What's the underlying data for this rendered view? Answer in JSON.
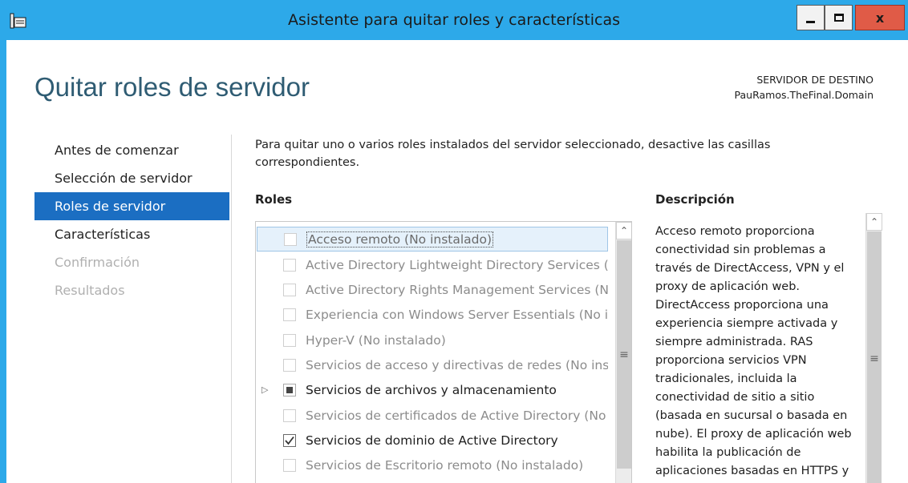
{
  "window": {
    "title": "Asistente para quitar roles y características",
    "icon": "server-manager-icon",
    "controls": {
      "minimize": "minimize-icon",
      "maximize": "maximize-icon",
      "close": "x"
    }
  },
  "header": {
    "page_title": "Quitar roles de servidor",
    "destination_label": "SERVIDOR DE DESTINO",
    "destination_server": "PauRamos.TheFinal.Domain"
  },
  "nav": {
    "items": [
      {
        "label": "Antes de comenzar",
        "state": "normal"
      },
      {
        "label": "Selección de servidor",
        "state": "normal"
      },
      {
        "label": "Roles de servidor",
        "state": "active"
      },
      {
        "label": "Características",
        "state": "normal"
      },
      {
        "label": "Confirmación",
        "state": "disabled"
      },
      {
        "label": "Resultados",
        "state": "disabled"
      }
    ]
  },
  "main": {
    "intro": "Para quitar uno o varios roles instalados del servidor seleccionado, desactive las casillas correspondientes.",
    "roles_header": "Roles",
    "description_header": "Descripción",
    "roles": [
      {
        "label": "Acceso remoto (No instalado)",
        "state": "unchecked",
        "enabled": false,
        "selected": true
      },
      {
        "label": "Active Directory Lightweight Directory Services (No instalado)",
        "state": "unchecked",
        "enabled": false
      },
      {
        "label": "Active Directory Rights Management Services (No instalado)",
        "state": "unchecked",
        "enabled": false
      },
      {
        "label": "Experiencia con Windows Server Essentials (No instalado)",
        "state": "unchecked",
        "enabled": false
      },
      {
        "label": "Hyper-V (No instalado)",
        "state": "unchecked",
        "enabled": false
      },
      {
        "label": "Servicios de acceso y directivas de redes (No instalado)",
        "state": "unchecked",
        "enabled": false
      },
      {
        "label": "Servicios de archivos y almacenamiento",
        "state": "partial",
        "enabled": true,
        "expandable": true
      },
      {
        "label": "Servicios de certificados de Active Directory (No instalado)",
        "state": "unchecked",
        "enabled": false
      },
      {
        "label": "Servicios de dominio de Active Directory",
        "state": "checked",
        "enabled": true
      },
      {
        "label": "Servicios de Escritorio remoto (No instalado)",
        "state": "unchecked",
        "enabled": false
      }
    ],
    "description": "Acceso remoto proporciona conectividad sin problemas a través de DirectAccess, VPN y el proxy de aplicación web. DirectAccess proporciona una experiencia siempre activada y siempre administrada. RAS proporciona servicios VPN tradicionales, incluida la conectividad de sitio a sitio (basada en sucursal o basada en nube). El proxy de aplicación web habilita la publicación de aplicaciones basadas en HTTPS y"
  },
  "colors": {
    "title_bar": "#2da9e9",
    "nav_active": "#1b6ec2",
    "page_title": "#2f5c73",
    "close_button": "#e05b47"
  }
}
